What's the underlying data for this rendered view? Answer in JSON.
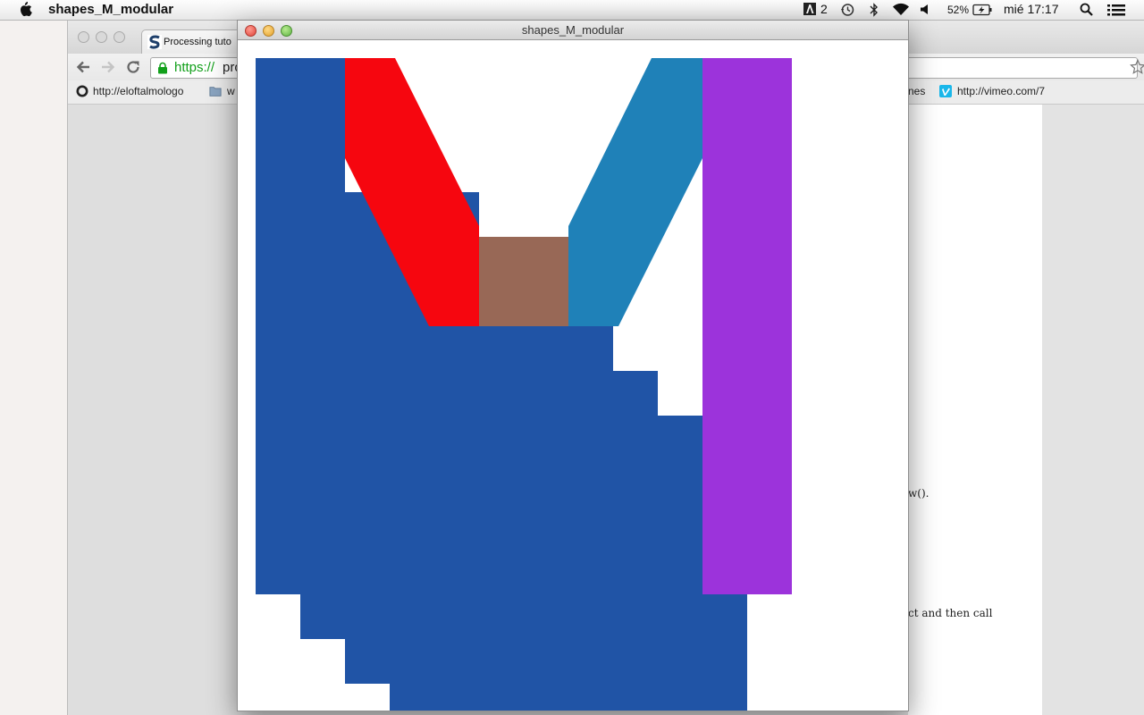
{
  "menubar": {
    "app_name": "shapes_M_modular",
    "adobe_count": "2",
    "battery_percent": "52%",
    "clock": "mié 17:17",
    "icons": [
      "apple-icon",
      "adobe-icon",
      "time-machine-icon",
      "bluetooth-icon",
      "wifi-icon",
      "volume-icon",
      "battery-icon",
      "spotlight-search-icon",
      "notification-list-icon"
    ]
  },
  "browser": {
    "tab_label": "Processing tuto",
    "url_scheme": "https://",
    "url_rest": "pro",
    "bookmarks": [
      {
        "label": "http://eloftalmologo"
      },
      {
        "label": "w"
      },
      {
        "label": "nes"
      },
      {
        "label": "http://vimeo.com/7"
      }
    ],
    "page_fragments": [
      "w().",
      "ct and then call"
    ]
  },
  "sketch": {
    "title": "shapes_M_modular",
    "colors": {
      "blue": "#2054a6",
      "red": "#f6060f",
      "brown": "#986856",
      "teal": "#1f81b8",
      "purple": "#9c33db",
      "background": "#ffffff"
    },
    "shapes": [
      "blue-step-shape",
      "red-diagonal-shape",
      "brown-square-shape",
      "teal-diagonal-shape",
      "purple-bar-shape"
    ]
  }
}
